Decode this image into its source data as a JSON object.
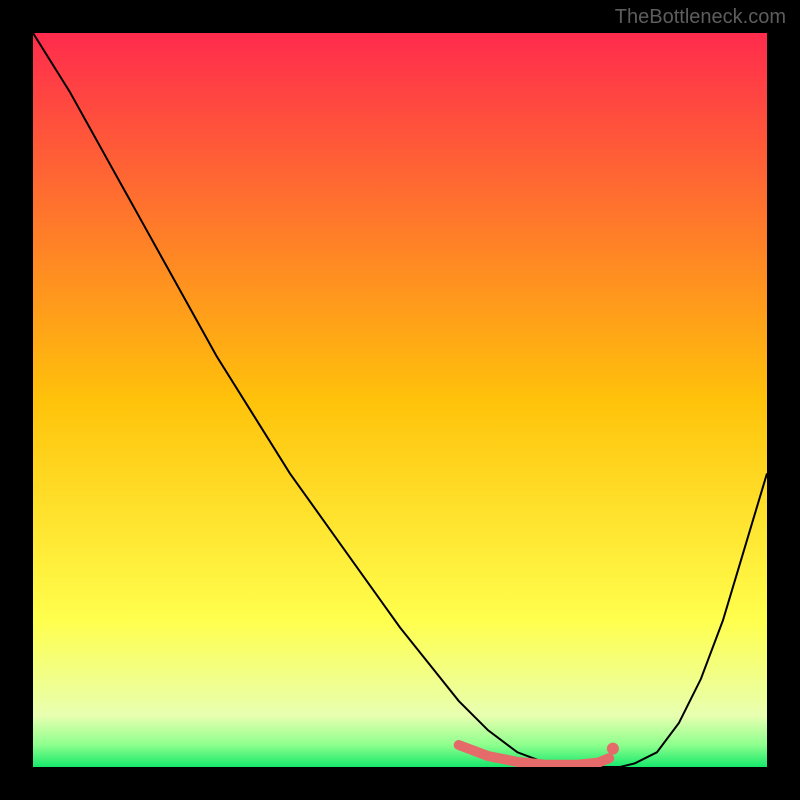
{
  "watermark": "TheBottleneck.com",
  "chart_data": {
    "type": "line",
    "title": "",
    "xlabel": "",
    "ylabel": "",
    "xlim": [
      0,
      100
    ],
    "ylim": [
      0,
      100
    ],
    "background_gradient": {
      "stops": [
        {
          "pos": 0.0,
          "color": "#ff2b4d"
        },
        {
          "pos": 0.5,
          "color": "#ffc20a"
        },
        {
          "pos": 0.8,
          "color": "#ffff4d"
        },
        {
          "pos": 0.93,
          "color": "#e8ffb0"
        },
        {
          "pos": 0.97,
          "color": "#8dff8d"
        },
        {
          "pos": 1.0,
          "color": "#17e86b"
        }
      ]
    },
    "series": [
      {
        "name": "curve",
        "color": "#000000",
        "x": [
          0,
          5,
          10,
          15,
          20,
          25,
          30,
          35,
          40,
          45,
          50,
          54,
          58,
          62,
          66,
          70,
          74,
          78,
          80,
          82,
          85,
          88,
          91,
          94,
          97,
          100
        ],
        "values": [
          100,
          92,
          83,
          74,
          65,
          56,
          48,
          40,
          33,
          26,
          19,
          14,
          9,
          5,
          2,
          0.5,
          0,
          0,
          0,
          0.5,
          2,
          6,
          12,
          20,
          30,
          40
        ]
      }
    ],
    "highlight_segment": {
      "color": "#e56a6a",
      "x": [
        58,
        62,
        66,
        70,
        74,
        77,
        78.5
      ],
      "values": [
        3,
        1.5,
        0.7,
        0.3,
        0.3,
        0.6,
        1.2
      ]
    },
    "highlight_dot": {
      "color": "#e56a6a",
      "x": 79.0,
      "value": 2.5
    }
  }
}
